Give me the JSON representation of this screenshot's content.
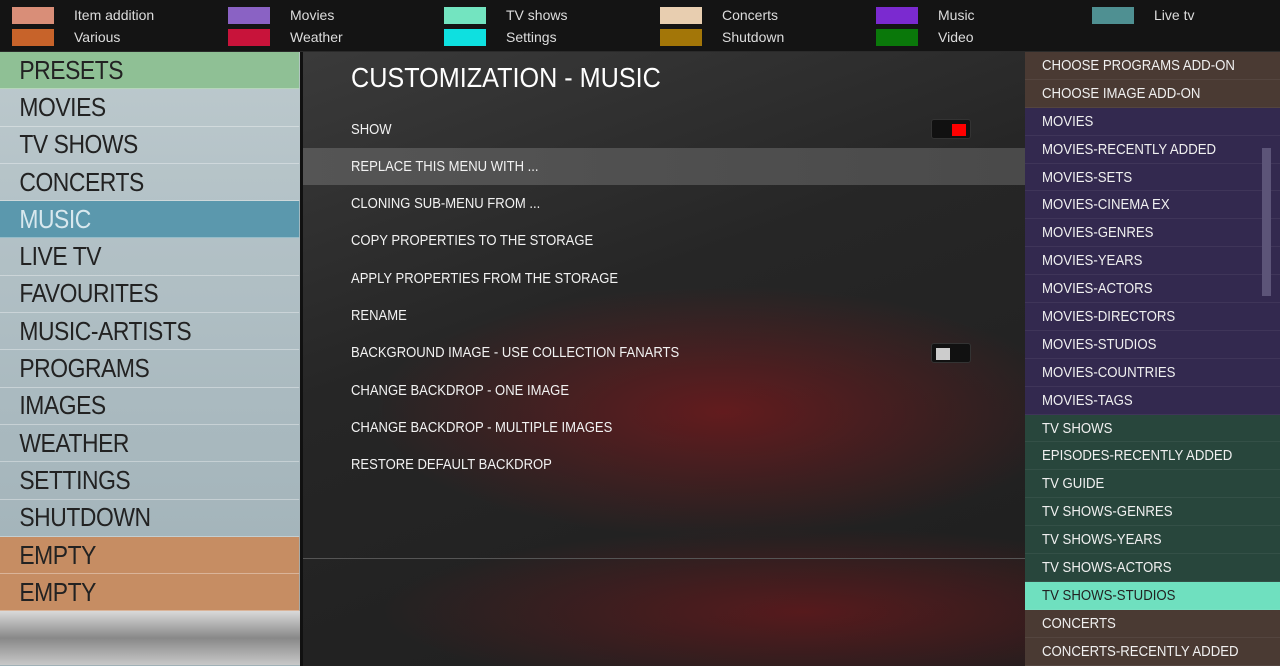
{
  "legend": [
    {
      "label": "Item addition",
      "color": "#d98e78"
    },
    {
      "label": "Various",
      "color": "#c7632a"
    },
    {
      "label": "Movies",
      "color": "#8a62c4"
    },
    {
      "label": "Weather",
      "color": "#c8133a"
    },
    {
      "label": "TV shows",
      "color": "#73e4c0"
    },
    {
      "label": "Settings",
      "color": "#0ee0e0"
    },
    {
      "label": "Concerts",
      "color": "#e8ceb0"
    },
    {
      "label": "Shutdown",
      "color": "#a37608"
    },
    {
      "label": "Music",
      "color": "#7b2ad0"
    },
    {
      "label": "Video",
      "color": "#0a780a"
    },
    {
      "label": "Live tv",
      "color": "#4f9092"
    }
  ],
  "left_menu": [
    "PRESETS",
    "MOVIES",
    "TV SHOWS",
    "CONCERTS",
    "MUSIC",
    "LIVE TV",
    "FAVOURITES",
    "MUSIC-ARTISTS",
    "PROGRAMS",
    "IMAGES",
    "WEATHER",
    "SETTINGS",
    "SHUTDOWN",
    "EMPTY",
    "EMPTY"
  ],
  "main": {
    "title": "CUSTOMIZATION - MUSIC",
    "options": [
      "SHOW",
      "REPLACE THIS MENU WITH ...",
      "CLONING SUB-MENU FROM ...",
      "COPY PROPERTIES TO THE STORAGE",
      "APPLY PROPERTIES FROM THE STORAGE",
      "RENAME",
      "BACKGROUND IMAGE - USE COLLECTION FANARTS",
      "CHANGE BACKDROP - ONE IMAGE",
      "CHANGE BACKDROP - MULTIPLE IMAGES",
      "RESTORE DEFAULT BACKDROP"
    ],
    "show_enabled": true,
    "fanarts_enabled": false
  },
  "right_list": [
    "CHOOSE PROGRAMS ADD-ON",
    "CHOOSE IMAGE ADD-ON",
    "MOVIES",
    "MOVIES-RECENTLY ADDED",
    "MOVIES-SETS",
    "MOVIES-CINEMA EX",
    "MOVIES-GENRES",
    "MOVIES-YEARS",
    "MOVIES-ACTORS",
    "MOVIES-DIRECTORS",
    "MOVIES-STUDIOS",
    "MOVIES-COUNTRIES",
    "MOVIES-TAGS",
    "TV SHOWS",
    "EPISODES-RECENTLY ADDED",
    "TV GUIDE",
    "TV SHOWS-GENRES",
    "TV SHOWS-YEARS",
    "TV SHOWS-ACTORS",
    "TV SHOWS-STUDIOS",
    "CONCERTS",
    "CONCERTS-RECENTLY ADDED"
  ]
}
